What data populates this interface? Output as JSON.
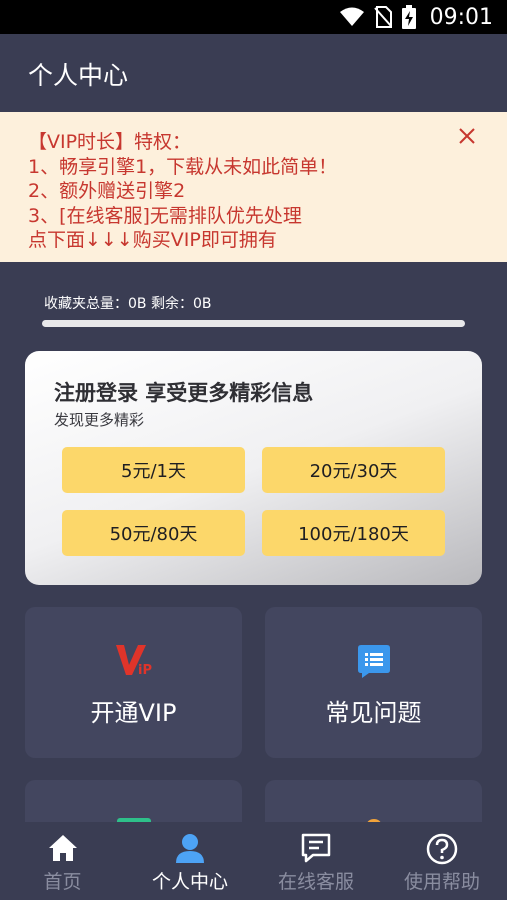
{
  "status_bar": {
    "time": "09:01",
    "icons": [
      "wifi-icon",
      "no-sim-icon",
      "battery-charging-icon"
    ]
  },
  "header": {
    "title": "个人中心"
  },
  "vip_notice": {
    "lines": [
      "【VIP时长】特权：",
      "1、畅享引擎1，下载从未如此简单！",
      "2、额外赠送引擎2",
      "3、[在线客服]无需排队优先处理",
      "点下面↓↓↓购买VIP即可拥有"
    ],
    "close_icon": "close-icon",
    "text_color": "#c7372f",
    "background": "#fdf0dc"
  },
  "storage": {
    "label": "收藏夹总量：0B 剩余：0B",
    "fill_fraction": 0
  },
  "promo": {
    "title": "注册登录 享受更多精彩信息",
    "subtitle": "发现更多精彩",
    "plans": [
      "5元/1天",
      "20元/30天",
      "50元/80天",
      "100元/180天"
    ],
    "plan_color": "#fcd76a"
  },
  "tiles": [
    {
      "label": "开通VIP",
      "icon": "vip-icon"
    },
    {
      "label": "常见问题",
      "icon": "faq-chat-icon"
    },
    {
      "label": "",
      "icon": "green-tile-icon"
    },
    {
      "label": "",
      "icon": "orange-tile-icon"
    }
  ],
  "bottom_nav": {
    "items": [
      {
        "label": "首页",
        "icon": "home-icon",
        "active": false
      },
      {
        "label": "个人中心",
        "icon": "user-icon",
        "active": true
      },
      {
        "label": "在线客服",
        "icon": "chat-icon",
        "active": false
      },
      {
        "label": "使用帮助",
        "icon": "help-icon",
        "active": false
      }
    ],
    "active_color": "#4da3f5",
    "inactive_color": "#8a8da0"
  },
  "colors": {
    "background": "#3a3d53",
    "tile": "#43465f",
    "accent_blue": "#4da3f5"
  }
}
